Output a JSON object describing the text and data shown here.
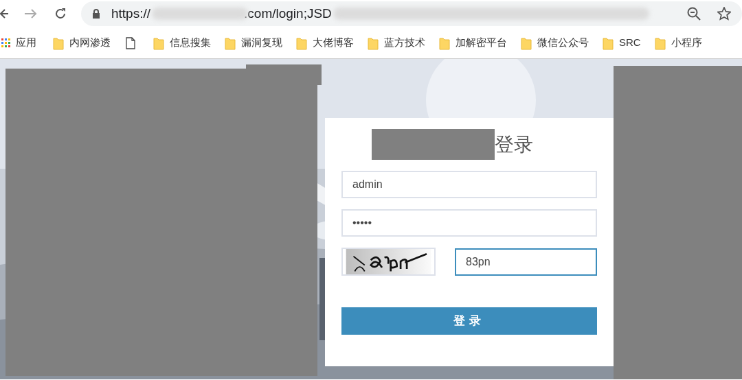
{
  "browser": {
    "url_parts": [
      "https://",
      ".com/login;JSD"
    ]
  },
  "bookmarks": [
    {
      "kind": "apps",
      "label": "应用"
    },
    {
      "kind": "folder",
      "label": "内网渗透"
    },
    {
      "kind": "page"
    },
    {
      "kind": "folder",
      "label": "信息搜集"
    },
    {
      "kind": "folder",
      "label": "漏洞复现"
    },
    {
      "kind": "folder",
      "label": "大佬博客"
    },
    {
      "kind": "folder",
      "label": "蓝方技术"
    },
    {
      "kind": "folder",
      "label": "加解密平台"
    },
    {
      "kind": "folder",
      "label": "微信公众号"
    },
    {
      "kind": "folder",
      "label": "SRC"
    },
    {
      "kind": "folder",
      "label": "小程序"
    }
  ],
  "login": {
    "title": "登录",
    "username": "admin",
    "password": "•••••",
    "captcha_value": "83pn",
    "captcha_focused": true,
    "submit": "登录"
  }
}
